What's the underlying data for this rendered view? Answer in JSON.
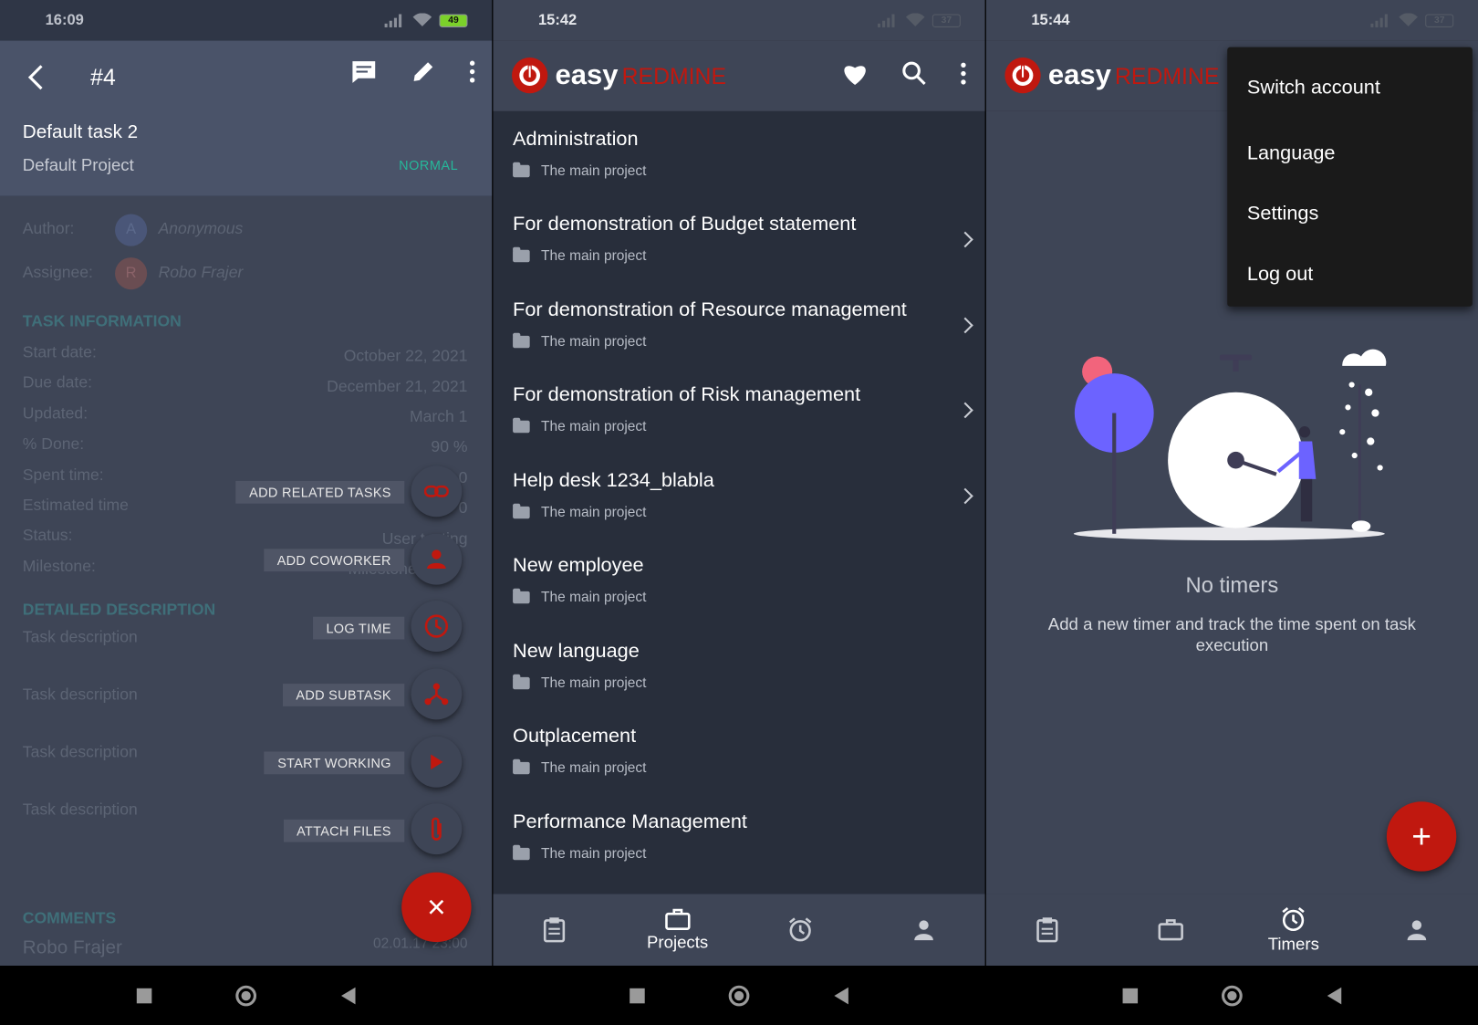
{
  "screen1": {
    "time": "16:09",
    "battery": "49",
    "task_number": "#4",
    "task_title": "Default task 2",
    "project": "Default Project",
    "priority": "NORMAL",
    "author_label": "Author:",
    "author_initial": "A",
    "author_name": "Anonymous",
    "assignee_label": "Assignee:",
    "assignee_initial": "R",
    "assignee_name": "Robo Frajer",
    "section_info": "TASK INFORMATION",
    "fields": [
      {
        "label": "Start date:",
        "value": "October 22, 2021"
      },
      {
        "label": "Due date:",
        "value": "December 21, 2021"
      },
      {
        "label": "Updated:",
        "value": "March 1"
      },
      {
        "label": "% Done:",
        "value": "90 %"
      },
      {
        "label": "Spent time:",
        "value": "0"
      },
      {
        "label": "Estimated time",
        "value": "0"
      },
      {
        "label": "Status:",
        "value": "User testing"
      },
      {
        "label": "Milestone:",
        "value": "Milestone"
      }
    ],
    "section_desc": "DETAILED DESCRIPTION",
    "descriptions": [
      "Task  description",
      "Task  description",
      "Task  description",
      "Task  description"
    ],
    "section_comments": "COMMENTS",
    "comment_author": "Robo Frajer",
    "comment_date": "02.01.17 23:00",
    "actions": [
      "ADD RELATED TASKS",
      "ADD COWORKER",
      "LOG TIME",
      "ADD SUBTASK",
      "START WORKING",
      "ATTACH FILES"
    ],
    "close_label": "×"
  },
  "screen2": {
    "time": "15:42",
    "battery": "37",
    "logo_easy": "easy",
    "logo_redmine": "REDMINE",
    "projects": [
      {
        "name": "Administration",
        "parent": "The main project",
        "has_children": false
      },
      {
        "name": "For demonstration of Budget statement",
        "parent": "The main project",
        "has_children": true
      },
      {
        "name": "For demonstration of Resource management",
        "parent": "The main project",
        "has_children": true
      },
      {
        "name": "For demonstration of Risk management",
        "parent": "The main project",
        "has_children": true
      },
      {
        "name": "Help desk 1234_blabla",
        "parent": "The main project",
        "has_children": true
      },
      {
        "name": "New employee",
        "parent": "The main project",
        "has_children": false
      },
      {
        "name": "New language",
        "parent": "The main project",
        "has_children": false
      },
      {
        "name": "Outplacement",
        "parent": "The main project",
        "has_children": false
      },
      {
        "name": "Performance Management",
        "parent": "The main project",
        "has_children": false
      }
    ],
    "tab_projects": "Projects"
  },
  "screen3": {
    "time": "15:44",
    "battery": "37",
    "menu": [
      "Switch account",
      "Language",
      "Settings",
      "Log out"
    ],
    "empty_title": "No timers",
    "empty_text": "Add a new timer and track the time spent on task execution",
    "tab_timers": "Timers",
    "fab_label": "+"
  },
  "colors": {
    "accent": "#c0180f",
    "header": "#3e4556",
    "list_bg": "#282e3b",
    "priority": "#26b79a"
  }
}
